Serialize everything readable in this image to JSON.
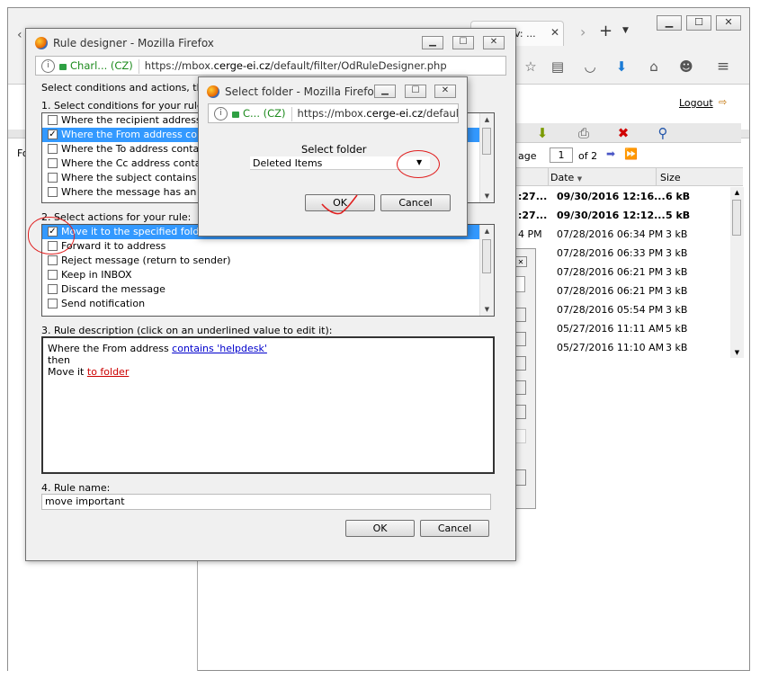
{
  "browser_bg": {
    "tab_title": "v: ...",
    "logout_label": "Logout",
    "pager": {
      "page_label": "age",
      "page_value": "1",
      "of_label": "of 2"
    },
    "columns": {
      "date": "Date",
      "size": "Size"
    },
    "folder_tree_label": "Fo",
    "rows": [
      {
        "time": ":27...",
        "date": "09/30/2016 12:16...",
        "size": "6 kB",
        "bold": true
      },
      {
        "time": ":27...",
        "date": "09/30/2016 12:12...",
        "size": "5 kB",
        "bold": true
      },
      {
        "time": "4 PM",
        "date": "07/28/2016 06:34 PM",
        "size": "3 kB",
        "bold": false
      },
      {
        "time": "",
        "date": "07/28/2016 06:33 PM",
        "size": "3 kB",
        "bold": false
      },
      {
        "time": "",
        "date": "07/28/2016 06:21 PM",
        "size": "3 kB",
        "bold": false
      },
      {
        "time": "",
        "date": "07/28/2016 06:21 PM",
        "size": "3 kB",
        "bold": false
      },
      {
        "time": "",
        "date": "07/28/2016 05:54 PM",
        "size": "3 kB",
        "bold": false
      },
      {
        "time": "",
        "date": "05/27/2016 11:11 AM",
        "size": "5 kB",
        "bold": false
      },
      {
        "time": "",
        "date": "05/27/2016 11:10 AM",
        "size": "3 kB",
        "bold": false
      }
    ]
  },
  "rule_designer": {
    "title": "Rule designer - Mozilla Firefox",
    "url_site": "Charl... (CZ)",
    "url_pre": "https://mbox.",
    "url_domain": "cerge-ei.cz",
    "url_post": "/default/filter/OdRuleDesigner.php",
    "intro": "Select conditions and actions, then s",
    "step1_label": "1. Select conditions for your rule:",
    "conditions": [
      {
        "label": "Where the recipient address (To",
        "checked": false,
        "selected": false
      },
      {
        "label": "Where the From address contai",
        "checked": true,
        "selected": true
      },
      {
        "label": "Where the To address contains",
        "checked": false,
        "selected": false
      },
      {
        "label": "Where the Cc address contains",
        "checked": false,
        "selected": false
      },
      {
        "label": "Where the subject contains wor",
        "checked": false,
        "selected": false
      },
      {
        "label": "Where the message has an atta",
        "checked": false,
        "selected": false
      }
    ],
    "step2_label": "2. Select actions for your rule:",
    "actions": [
      {
        "label": "Move it to the specified folder",
        "checked": true,
        "selected": true
      },
      {
        "label": "Forward it to address",
        "checked": false,
        "selected": false
      },
      {
        "label": "Reject message (return to sender)",
        "checked": false,
        "selected": false
      },
      {
        "label": "Keep in INBOX",
        "checked": false,
        "selected": false
      },
      {
        "label": "Discard the message",
        "checked": false,
        "selected": false
      },
      {
        "label": "Send notification",
        "checked": false,
        "selected": false
      }
    ],
    "step3_label": "3. Rule description (click on an underlined value to edit it):",
    "desc": {
      "line1_pre": "Where the From address ",
      "line1_link": "contains 'helpdesk'",
      "line2": "then",
      "line3_pre": "Move it ",
      "line3_link": "to folder"
    },
    "step4_label": "4. Rule name:",
    "rule_name": "move important",
    "ok_label": "OK",
    "cancel_label": "Cancel"
  },
  "select_folder": {
    "title": "Select folder - Mozilla Firefox",
    "url_site": "C... (CZ)",
    "url_pre": "https://mbox.",
    "url_domain": "cerge-ei.cz",
    "url_post": "/default/fi",
    "heading": "Select folder",
    "selected_folder": "Deleted Items",
    "ok_label": "OK",
    "cancel_label": "Cancel"
  },
  "colors": {
    "selection": "#3399ff",
    "link_blue": "#0000cc",
    "link_red": "#cc0000",
    "annotation_red": "#e02020"
  }
}
